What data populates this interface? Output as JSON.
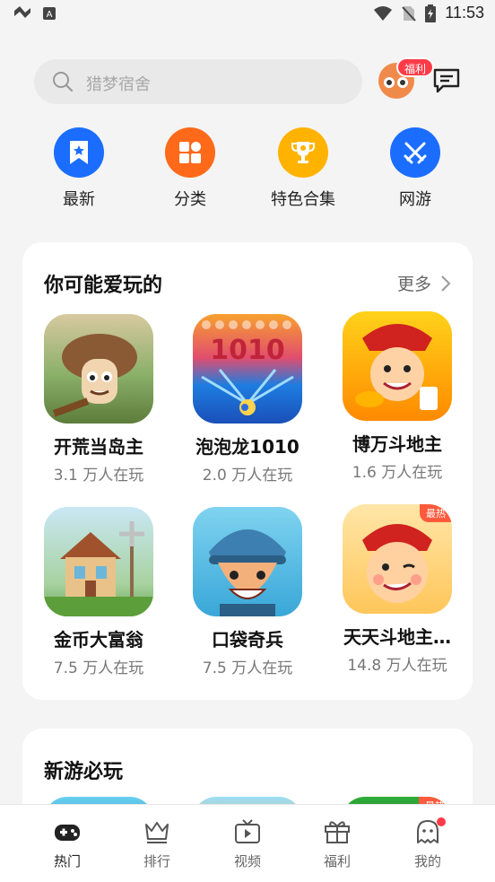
{
  "status_bar": {
    "time": "11:53"
  },
  "search": {
    "placeholder": "猎梦宿舍"
  },
  "header": {
    "welfare_badge": "福利"
  },
  "quick_nav": [
    {
      "label": "最新",
      "color": "#1a6dff",
      "icon": "bookmark-star-icon"
    },
    {
      "label": "分类",
      "color": "#ff6a1a",
      "icon": "grid-icon"
    },
    {
      "label": "特色合集",
      "color": "#ffb300",
      "icon": "trophy-icon"
    },
    {
      "label": "网游",
      "color": "#1a6dff",
      "icon": "crossed-swords-icon"
    }
  ],
  "recommend": {
    "title": "你可能爱玩的",
    "more": "更多",
    "games": [
      {
        "name": "开荒当岛主",
        "players": "3.1 万人在玩",
        "badge": ""
      },
      {
        "name": "泡泡龙1010",
        "players": "2.0 万人在玩",
        "badge": ""
      },
      {
        "name": "博万斗地主",
        "players": "1.6 万人在玩",
        "badge": ""
      },
      {
        "name": "金币大富翁",
        "players": "7.5 万人在玩",
        "badge": ""
      },
      {
        "name": "口袋奇兵",
        "players": "7.5 万人在玩",
        "badge": ""
      },
      {
        "name": "天天斗地主…",
        "players": "14.8 万人在玩",
        "badge": "最热"
      }
    ]
  },
  "new_games": {
    "title": "新游必玩",
    "badge": "最热"
  },
  "bottom_nav": [
    {
      "label": "热门",
      "icon": "gamepad-icon",
      "active": true
    },
    {
      "label": "排行",
      "icon": "crown-icon",
      "active": false
    },
    {
      "label": "视频",
      "icon": "tv-play-icon",
      "active": false
    },
    {
      "label": "福利",
      "icon": "gift-icon",
      "active": false
    },
    {
      "label": "我的",
      "icon": "ghost-icon",
      "active": false
    }
  ],
  "colors": {
    "accent_red": "#ff3b47",
    "hot_badge": "#ff5a3c"
  }
}
